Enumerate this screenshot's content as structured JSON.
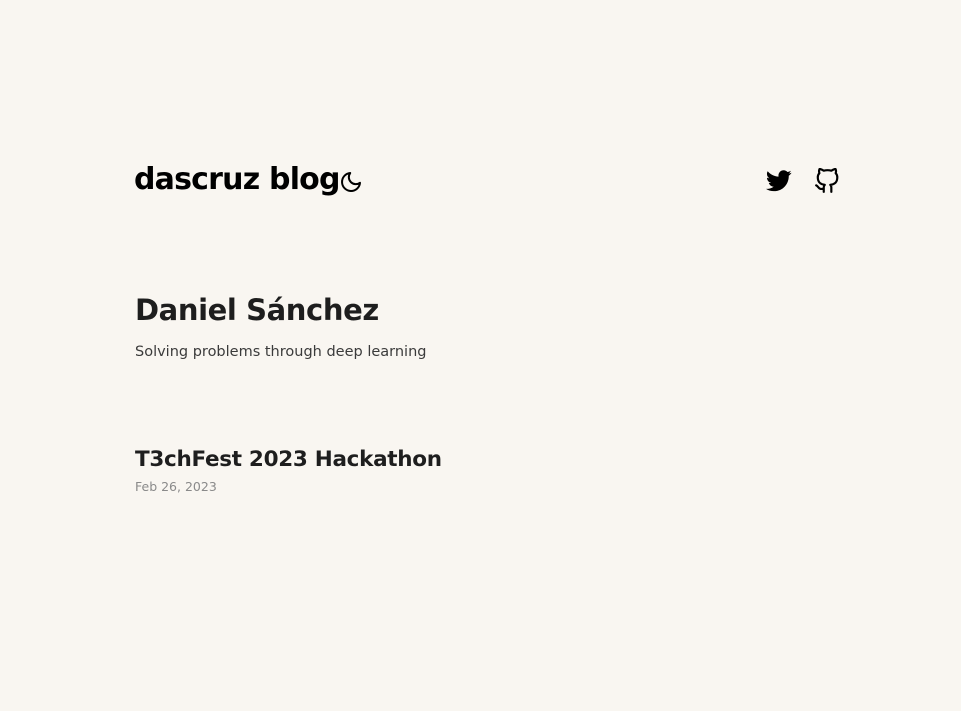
{
  "header": {
    "logo": "dascruz blog",
    "theme_toggle_icon": "moon-icon",
    "social": [
      {
        "icon": "twitter-icon"
      },
      {
        "icon": "github-icon"
      }
    ]
  },
  "profile": {
    "name": "Daniel Sánchez",
    "tagline": "Solving problems through deep learning"
  },
  "posts": [
    {
      "title": "T3chFest 2023 Hackathon",
      "date": "Feb 26, 2023"
    }
  ],
  "colors": {
    "background": "#f9f6f1",
    "text": "#1e1e1e",
    "muted": "#8a8a8a"
  }
}
